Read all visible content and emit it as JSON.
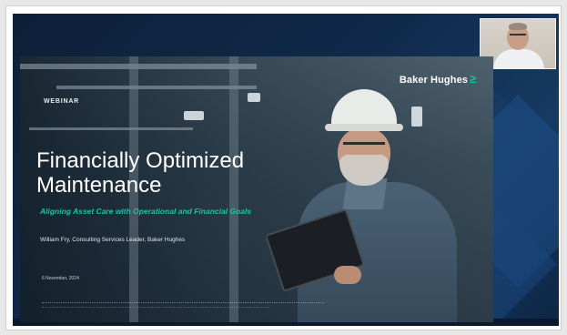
{
  "slide": {
    "tag": "WEBINAR",
    "brand": "Baker Hughes",
    "brand_mark": "≥",
    "title_line1": "Financially Optimized",
    "title_line2": "Maintenance",
    "subtitle": "Aligning Asset Care with Operational and Financial Goals",
    "presenter": "William Fry, Consulting Services Leader, Baker Hughes",
    "date": "6 November, 2024"
  },
  "colors": {
    "accent": "#19c3a8",
    "background": "#10294a",
    "text": "#ffffff"
  }
}
